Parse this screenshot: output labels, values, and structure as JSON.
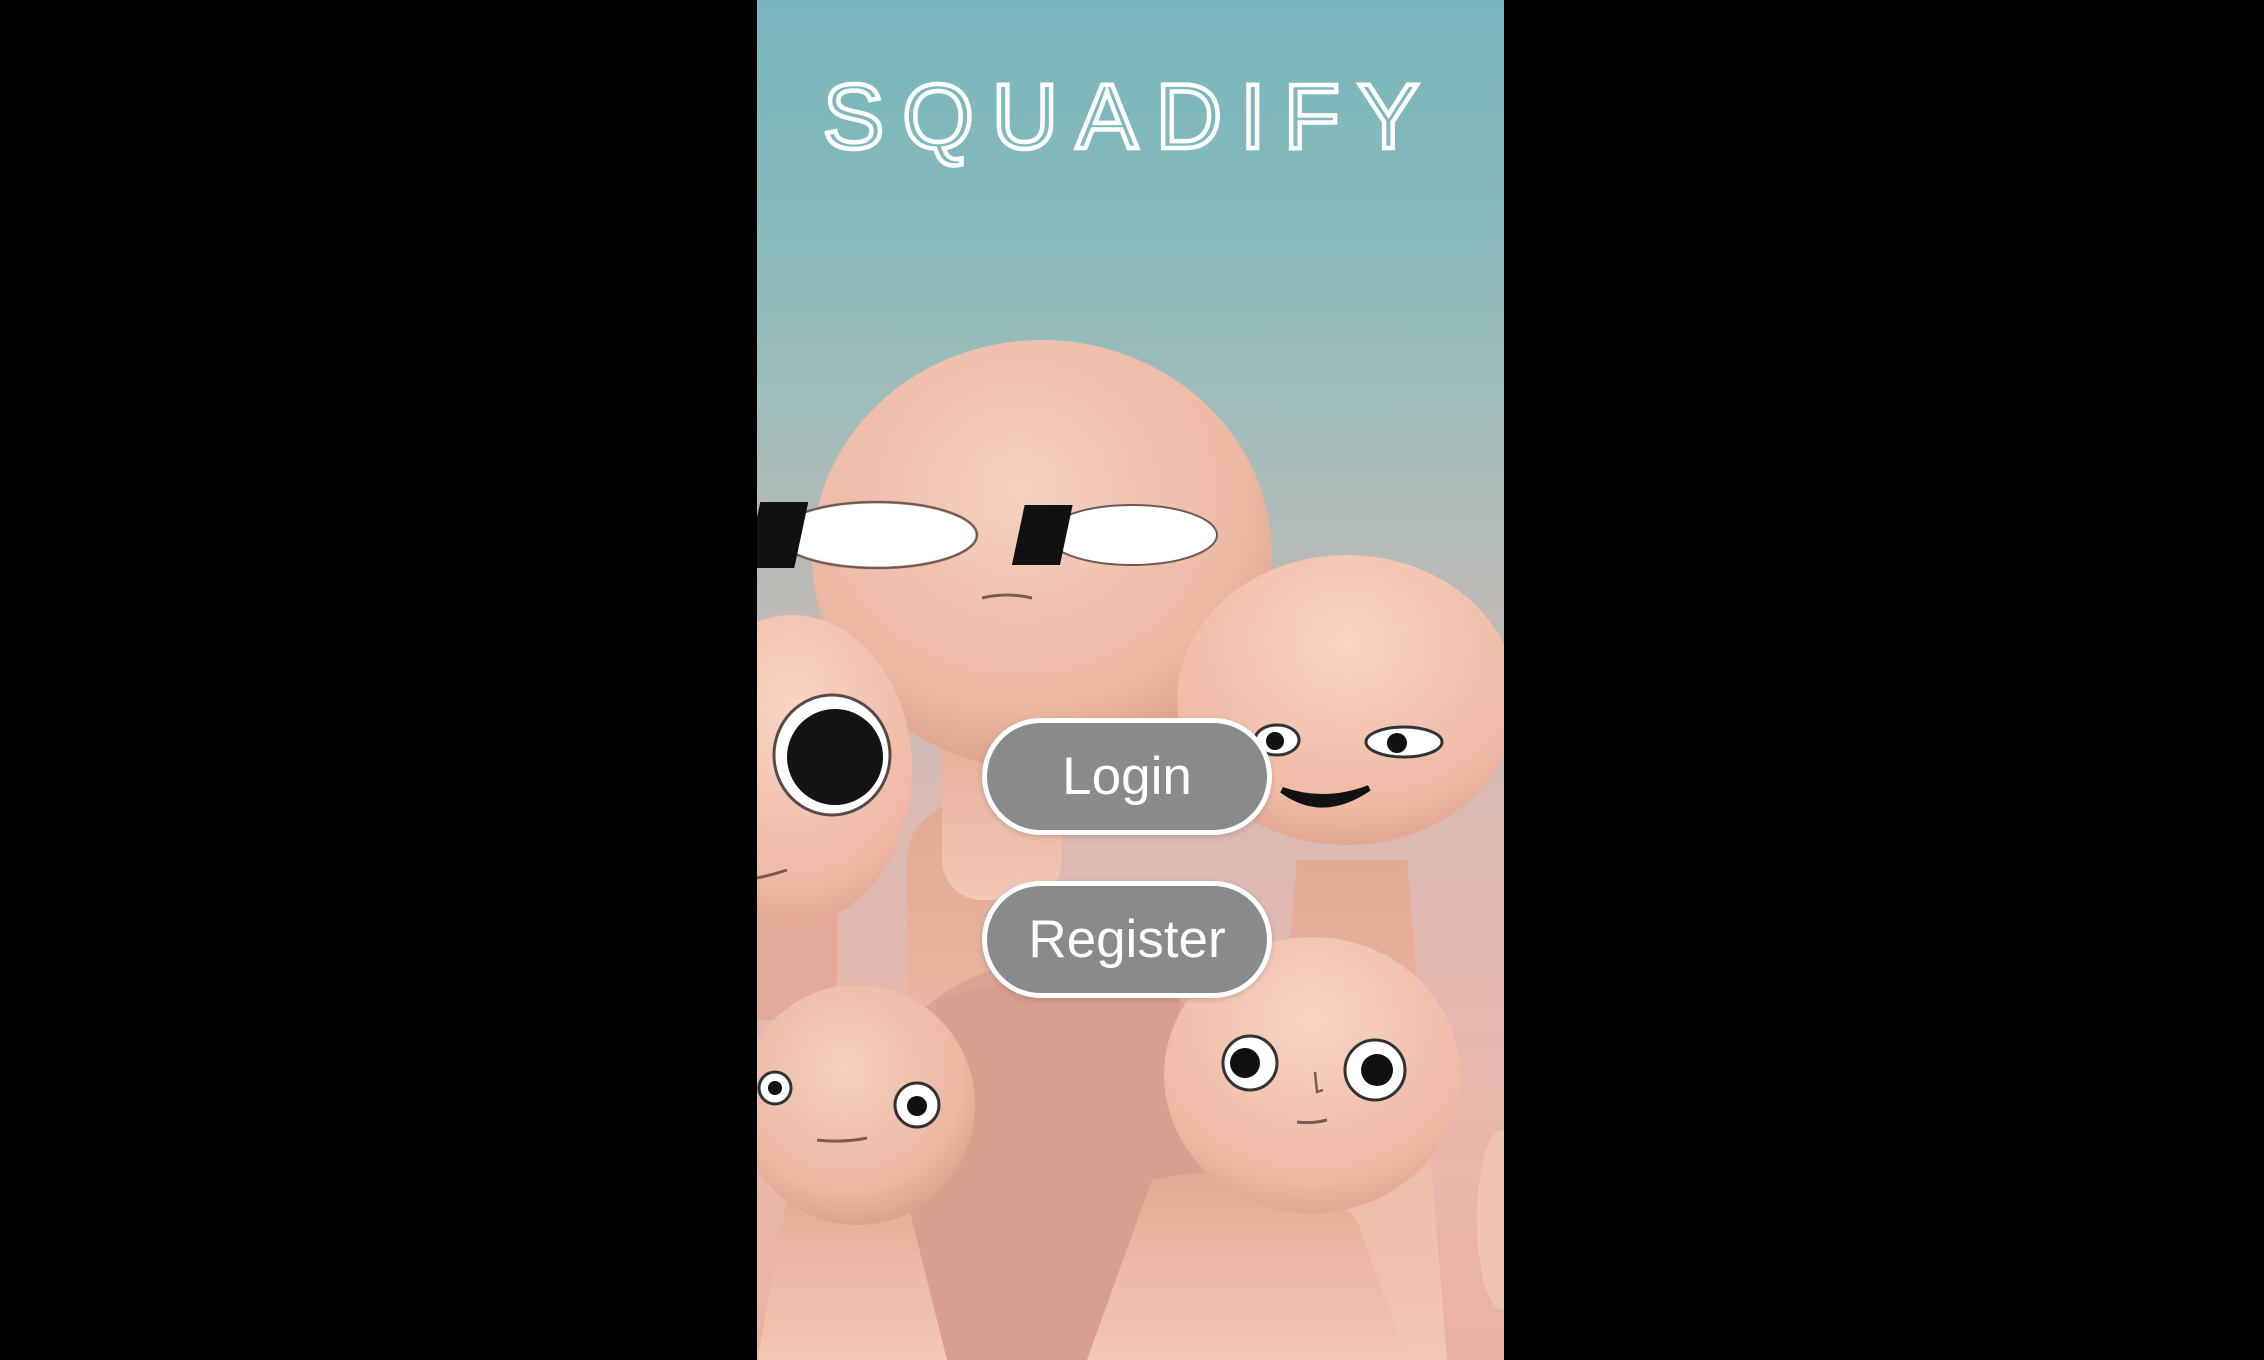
{
  "app": {
    "logo_text": "SQUADIFY"
  },
  "actions": {
    "login_label": "Login",
    "register_label": "Register"
  },
  "colors": {
    "letterbox": "#000000",
    "sky_top": "#78b6bd",
    "sky_bottom": "#e9b2a6",
    "button_fill": "#8a8a8a",
    "button_border": "#ffffff",
    "character_skin": "#f1c1ae"
  },
  "illustration": {
    "description_name": "cartoon-characters-group"
  }
}
